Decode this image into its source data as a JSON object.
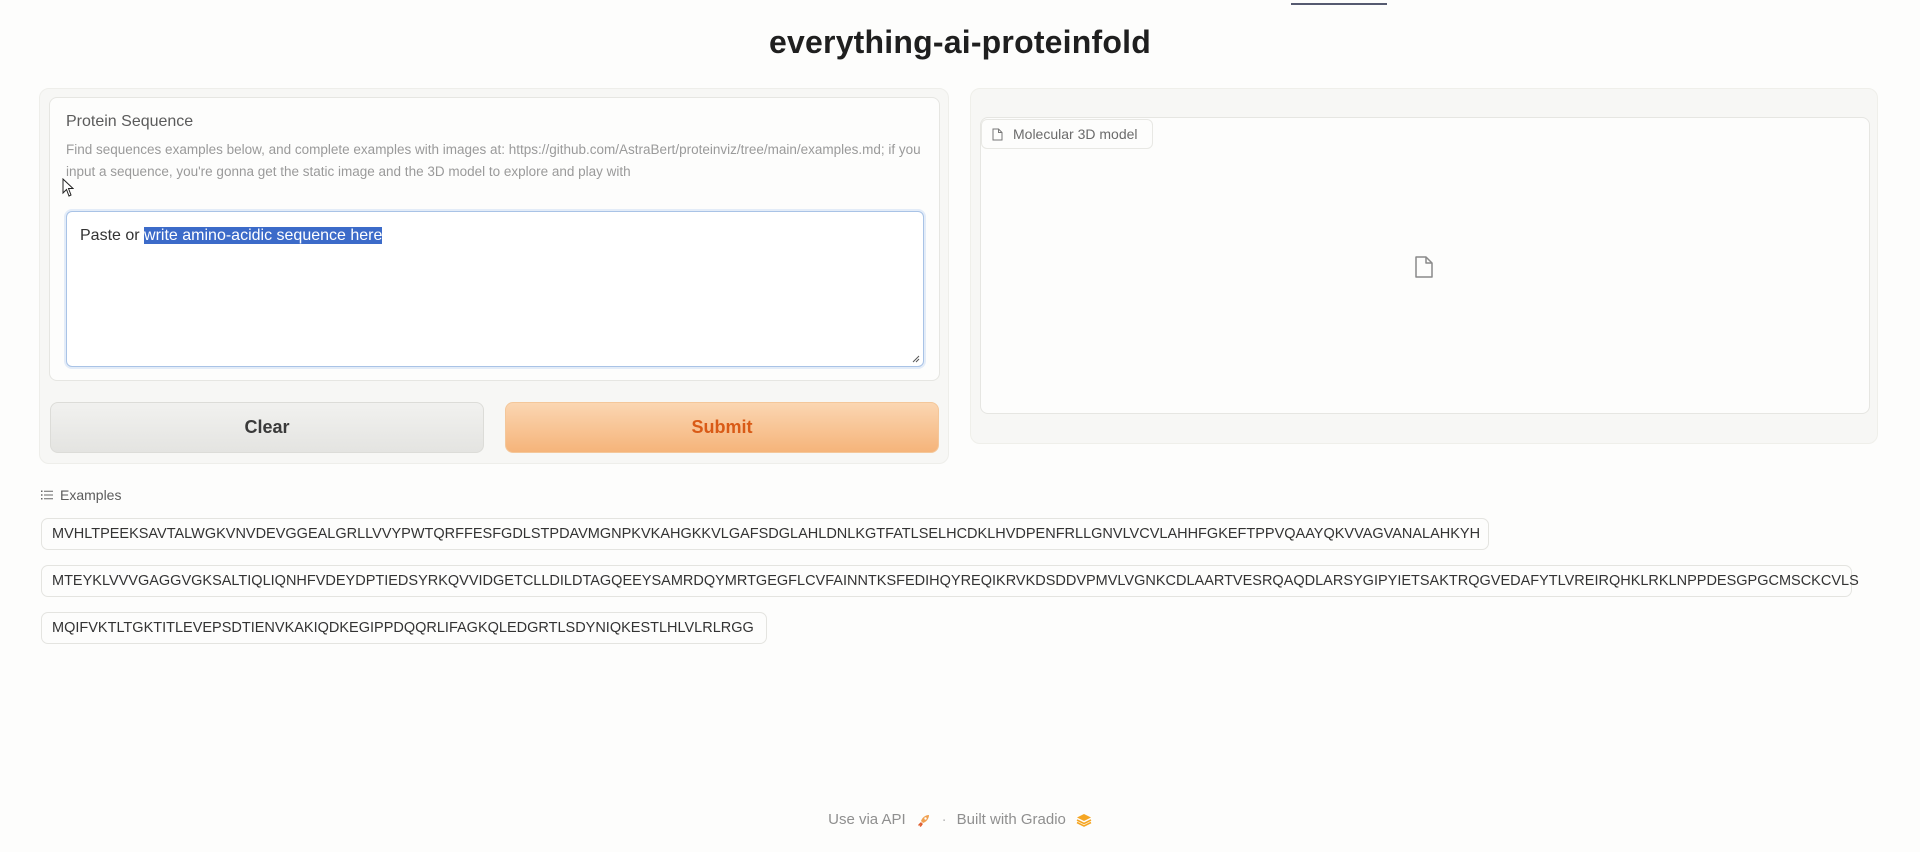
{
  "app": {
    "title": "everything-ai-proteinfold"
  },
  "input": {
    "label": "Protein Sequence",
    "info": "Find sequences examples below, and complete examples with images at: https://github.com/AstraBert/proteinviz/tree/main/examples.md; if you input a sequence, you're gonna get the static image and the 3D model to explore and play with",
    "text_before": "Paste or ",
    "text_selected": "write amino-acidic sequence here"
  },
  "buttons": {
    "clear_label": "Clear",
    "submit_label": "Submit"
  },
  "output": {
    "label": "Molecular 3D model"
  },
  "examples": {
    "header": "Examples",
    "items": [
      "MVHLTPEEKSAVTALWGKVNVDEVGGEALGRLLVVYPWTQRFFESFGDLSTPDAVMGNPKVKAHGKKVLGAFSDGLAHLDNLKGTFATLSELHCDKLHVDPENFRLLGNVLVCVLAHHFGKEFTPPVQAAYQKVVAGVANALAHKYH",
      "MTEYKLVVVGAGGVGKSALTIQLIQNHFVDEYDPTIEDSYRKQVVIDGETCLLDILDTAGQEEYSAMRDQYMRTGEGFLCVFAINNTKSFEDIHQYREQIKRVKDSDDVPMVLVGNKCDLAARTVESRQAQDLARSYGIPYIETSAKTRQGVEDAFYTLVREIRQHKLRKLNPPDESGPGCMSCKCVLS",
      "MQIFVKTLTGKTITLEVEPSDTIENVKAKIQDKEGIPPDQQRLIFAGKQLEDGRTLSDYNIQKESTLHLVLRLRGG"
    ]
  },
  "footer": {
    "api_label": "Use via API",
    "built_label": "Built with Gradio"
  },
  "colors": {
    "accent": "#f5b47a",
    "submit_text": "#d95a16",
    "selection": "#3c6bc9"
  }
}
